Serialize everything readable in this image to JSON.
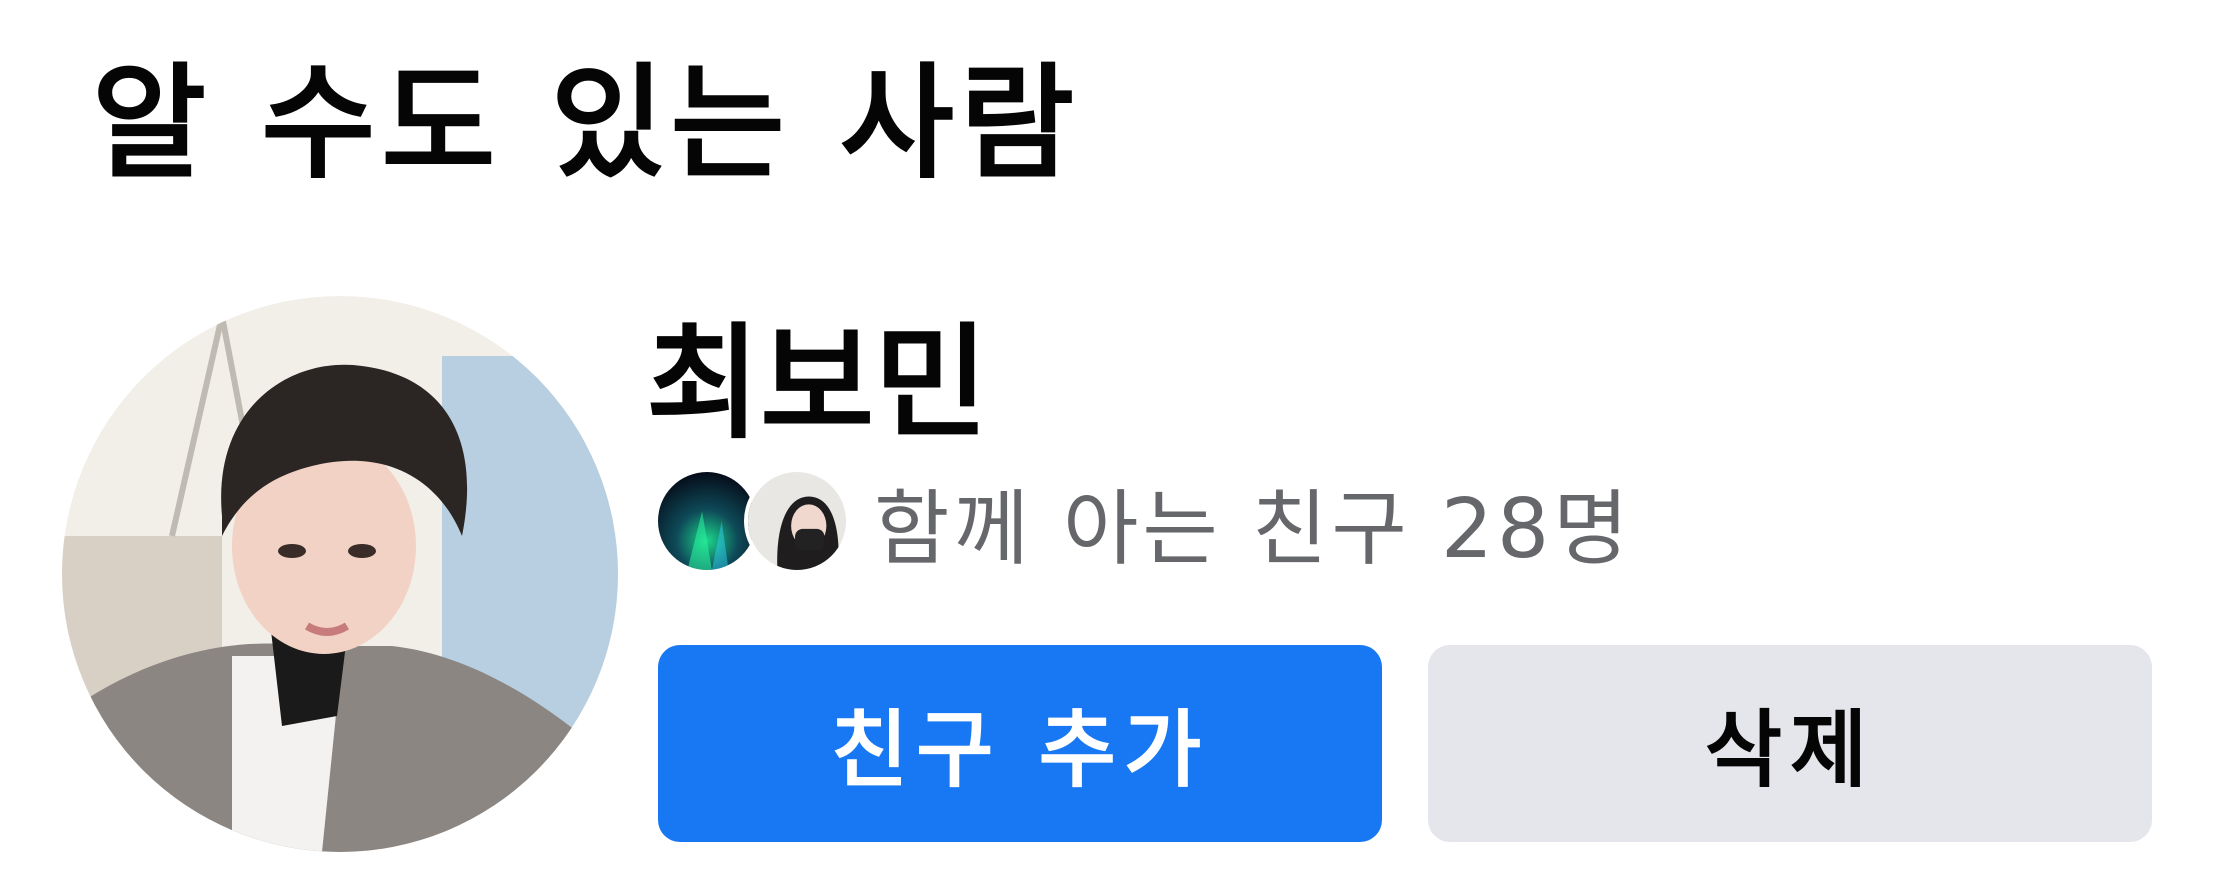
{
  "section": {
    "title": "알 수도 있는 사람"
  },
  "suggestion": {
    "name": "최보민",
    "mutual_friends_text": "함께 아는 친구 28명",
    "add_friend_label": "친구 추가",
    "remove_label": "삭제"
  },
  "colors": {
    "primary": "#1877f2",
    "secondary": "#e4e6eb",
    "text": "#050505",
    "subtext": "#65676b"
  }
}
